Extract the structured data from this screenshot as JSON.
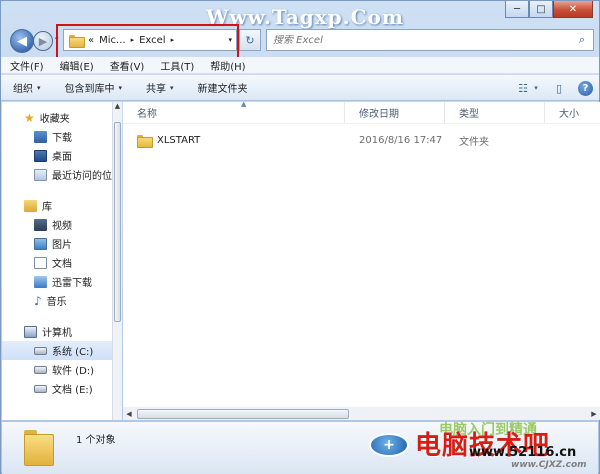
{
  "window": {
    "caption_buttons": {
      "minimize": "─",
      "maximize": "□",
      "close": "✕"
    },
    "watermark_top": "Www.Tagxp.Com"
  },
  "nav": {
    "back_glyph": "◀",
    "forward_glyph": "▶",
    "history_glyph": "▾"
  },
  "address": {
    "prefix": "«",
    "crumbs": [
      "Mic...",
      "Excel"
    ],
    "separator": "▸",
    "dropdown": "▾",
    "refresh_glyph": "↻"
  },
  "search": {
    "placeholder": "搜索 Excel",
    "icon_glyph": "⌕"
  },
  "menubar": {
    "items": [
      "文件(F)",
      "编辑(E)",
      "查看(V)",
      "工具(T)",
      "帮助(H)"
    ]
  },
  "toolbar": {
    "organize": "组织",
    "include_in_library": "包含到库中",
    "share": "共享",
    "new_folder": "新建文件夹",
    "caret": "▾",
    "view_glyph": "☷",
    "preview_glyph": "▯",
    "help_glyph": "?"
  },
  "sidebar": {
    "favorites": {
      "label": "收藏夹",
      "items": [
        "下载",
        "桌面",
        "最近访问的位置"
      ]
    },
    "libraries": {
      "label": "库",
      "items": [
        "视频",
        "图片",
        "文档",
        "迅雷下载",
        "音乐"
      ]
    },
    "computer": {
      "label": "计算机",
      "items": [
        "系统 (C:)",
        "软件 (D:)",
        "文档 (E:)"
      ]
    }
  },
  "columns": {
    "name": "名称",
    "modified": "修改日期",
    "type": "类型",
    "size": "大小",
    "sort_glyph": "▲"
  },
  "files": [
    {
      "name": "XLSTART",
      "modified": "2016/8/16 17:47",
      "type": "文件夹",
      "size": ""
    }
  ],
  "status": {
    "count": "1 个对象"
  },
  "watermark_bottom": {
    "line1": "电脑入门到精通",
    "line2": "电脑技术吧",
    "url": "www.52116.cn",
    "url2": "www.CJXZ.com",
    "logo": "+"
  },
  "colors": {
    "highlight": "#d6101a",
    "accent": "#3d6eb3"
  }
}
